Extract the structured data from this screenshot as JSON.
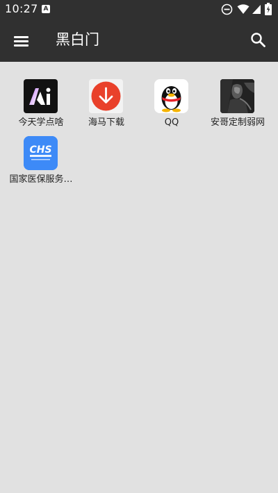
{
  "status_bar": {
    "time": "10:27",
    "notification_icon": "a-letter-icon",
    "icons": [
      "do-not-disturb-icon",
      "wifi-icon",
      "signal-icon",
      "battery-charging-icon"
    ]
  },
  "app_bar": {
    "title": "黑白门",
    "menu_icon": "menu-icon",
    "search_icon": "search-icon"
  },
  "apps": [
    {
      "name": "今天学点啥",
      "icon": "ai-logo-icon"
    },
    {
      "name": "海马下载",
      "icon": "download-arrow-icon"
    },
    {
      "name": "QQ",
      "icon": "qq-penguin-icon"
    },
    {
      "name": "安哥定制弱网",
      "icon": "dark-photo-icon"
    },
    {
      "name": "国家医保服务…",
      "icon": "chs-logo-icon"
    }
  ],
  "colors": {
    "bar_background": "#303030",
    "page_background": "#e1e1e1",
    "download_red": "#e9412b",
    "chs_blue": "#3d8af7"
  }
}
